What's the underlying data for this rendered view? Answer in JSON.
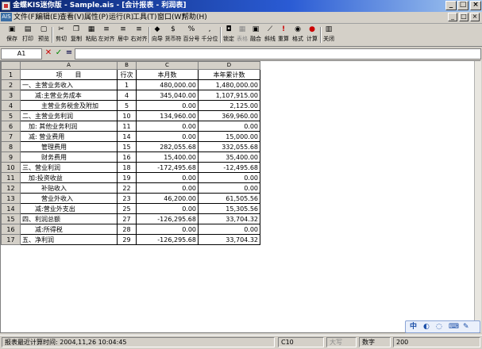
{
  "window": {
    "title": "金蝶KIS迷你版 - Sample.ais - [会计报表 - 利润表]",
    "minimize_glyph": "_",
    "maximize_glyph": "□",
    "close_glyph": "×"
  },
  "menu": {
    "items": [
      "文件(F)",
      "编辑(E)",
      "查看(V)",
      "属性(P)",
      "运行(R)",
      "工具(T)",
      "窗口(W)",
      "帮助(H)"
    ],
    "doc_icon_text": "AIS"
  },
  "toolbar": {
    "items": [
      {
        "label": "保存",
        "icon": "save-icon",
        "glyph": "▣"
      },
      {
        "label": "打印",
        "icon": "print-icon",
        "glyph": "▤"
      },
      {
        "label": "预览",
        "icon": "preview-icon",
        "glyph": "▢"
      },
      {
        "label": "剪切",
        "icon": "cut-icon",
        "glyph": "✂"
      },
      {
        "label": "复制",
        "icon": "copy-icon",
        "glyph": "❐"
      },
      {
        "label": "粘贴",
        "icon": "paste-icon",
        "glyph": "▦"
      },
      {
        "label": "左对齐",
        "icon": "align-left-icon",
        "glyph": "≡"
      },
      {
        "label": "居中",
        "icon": "align-center-icon",
        "glyph": "≡"
      },
      {
        "label": "右对齐",
        "icon": "align-right-icon",
        "glyph": "≡"
      },
      {
        "label": "向导",
        "icon": "wizard-icon",
        "glyph": "◆"
      },
      {
        "label": "货币符",
        "icon": "currency-icon",
        "glyph": "$"
      },
      {
        "label": "百分号",
        "icon": "percent-icon",
        "glyph": "%"
      },
      {
        "label": "千分位",
        "icon": "thousands-icon",
        "glyph": ","
      },
      {
        "label": "锁定",
        "icon": "lock-icon",
        "glyph": "◘"
      },
      {
        "label": "表格",
        "icon": "table-icon",
        "glyph": "▦",
        "disabled": true
      },
      {
        "label": "融合",
        "icon": "merge-icon",
        "glyph": "▣"
      },
      {
        "label": "斜线",
        "icon": "diagonal-icon",
        "glyph": "⟋"
      },
      {
        "label": "重算",
        "icon": "recalc-icon",
        "glyph": "!"
      },
      {
        "label": "格式",
        "icon": "format-icon",
        "glyph": "◉"
      },
      {
        "label": "计算",
        "icon": "calc-icon",
        "glyph": "●"
      },
      {
        "label": "关闭",
        "icon": "close-sheet-icon",
        "glyph": "▥"
      }
    ]
  },
  "formula_bar": {
    "cell_ref": "A1",
    "cancel_glyph": "✕",
    "confirm_glyph": "✓",
    "fx_glyph": "=",
    "value": ""
  },
  "sheet": {
    "column_letters": [
      "A",
      "B",
      "C",
      "D"
    ],
    "headers": [
      "项　　目",
      "行次",
      "本月数",
      "本年累计数"
    ],
    "rows": [
      {
        "item": "一、主营业务收入",
        "line": "1",
        "month": "480,000.00",
        "ytd": "1,480,000.00"
      },
      {
        "item": "　　减:主营业务成本",
        "line": "4",
        "month": "345,040.00",
        "ytd": "1,107,915.00"
      },
      {
        "item": "　　　主营业务税金及附加",
        "line": "5",
        "month": "0.00",
        "ytd": "2,125.00"
      },
      {
        "item": "二、主营业务利润",
        "line": "10",
        "month": "134,960.00",
        "ytd": "369,960.00"
      },
      {
        "item": "　加: 其他业务利润",
        "line": "11",
        "month": "0.00",
        "ytd": "0.00"
      },
      {
        "item": "　减: 营业费用",
        "line": "14",
        "month": "0.00",
        "ytd": "15,000.00"
      },
      {
        "item": "　　　管理费用",
        "line": "15",
        "month": "282,055.68",
        "ytd": "332,055.68"
      },
      {
        "item": "　　　财务费用",
        "line": "16",
        "month": "15,400.00",
        "ytd": "35,400.00"
      },
      {
        "item": "三、营业利润",
        "line": "18",
        "month": "-172,495.68",
        "ytd": "-12,495.68"
      },
      {
        "item": "　加:投资收益",
        "line": "19",
        "month": "0.00",
        "ytd": "0.00"
      },
      {
        "item": "　　　补贴收入",
        "line": "22",
        "month": "0.00",
        "ytd": "0.00"
      },
      {
        "item": "　　　营业外收入",
        "line": "23",
        "month": "46,200.00",
        "ytd": "61,505.56"
      },
      {
        "item": "　　减:营业外支出",
        "line": "25",
        "month": "0.00",
        "ytd": "15,305.56"
      },
      {
        "item": "四、利润总额",
        "line": "27",
        "month": "-126,295.68",
        "ytd": "33,704.32"
      },
      {
        "item": "　　减:所得税",
        "line": "28",
        "month": "0.00",
        "ytd": "0.00"
      },
      {
        "item": "五、净利润",
        "line": "29",
        "month": "-126,295.68",
        "ytd": "33,704.32"
      }
    ]
  },
  "status": {
    "last_calc": "报表最近计算时间: 2004,11,26 10:04:45",
    "cell": "C10",
    "caps": "大写",
    "num": "数字",
    "extra": "200"
  },
  "tray": {
    "ime_glyphs": [
      "中",
      "◐",
      "◌",
      "⌨",
      "✎"
    ]
  }
}
